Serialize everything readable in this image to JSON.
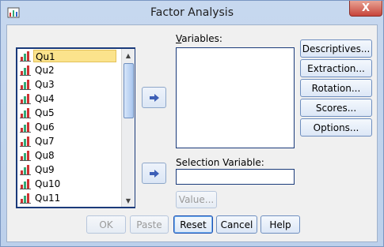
{
  "window": {
    "title": "Factor Analysis",
    "close_glyph": "X"
  },
  "variable_list": {
    "items": [
      "Qu1",
      "Qu2",
      "Qu3",
      "Qu4",
      "Qu5",
      "Qu6",
      "Qu7",
      "Qu8",
      "Qu9",
      "Qu10",
      "Qu11"
    ],
    "selected": "Qu1"
  },
  "labels": {
    "variables": "Variables:",
    "selection_variable": "Selection Variable:"
  },
  "side_buttons": {
    "descriptives": "Descriptives...",
    "extraction": "Extraction...",
    "rotation": "Rotation...",
    "scores": "Scores...",
    "options": "Options..."
  },
  "value_button": "Value...",
  "bottom_buttons": {
    "ok": "OK",
    "paste": "Paste",
    "reset": "Reset",
    "cancel": "Cancel",
    "help": "Help"
  },
  "colors": {
    "selection_highlight": "#fbe38c",
    "arrow_blue": "#3d5fb7",
    "close_red": "#c7453b"
  }
}
